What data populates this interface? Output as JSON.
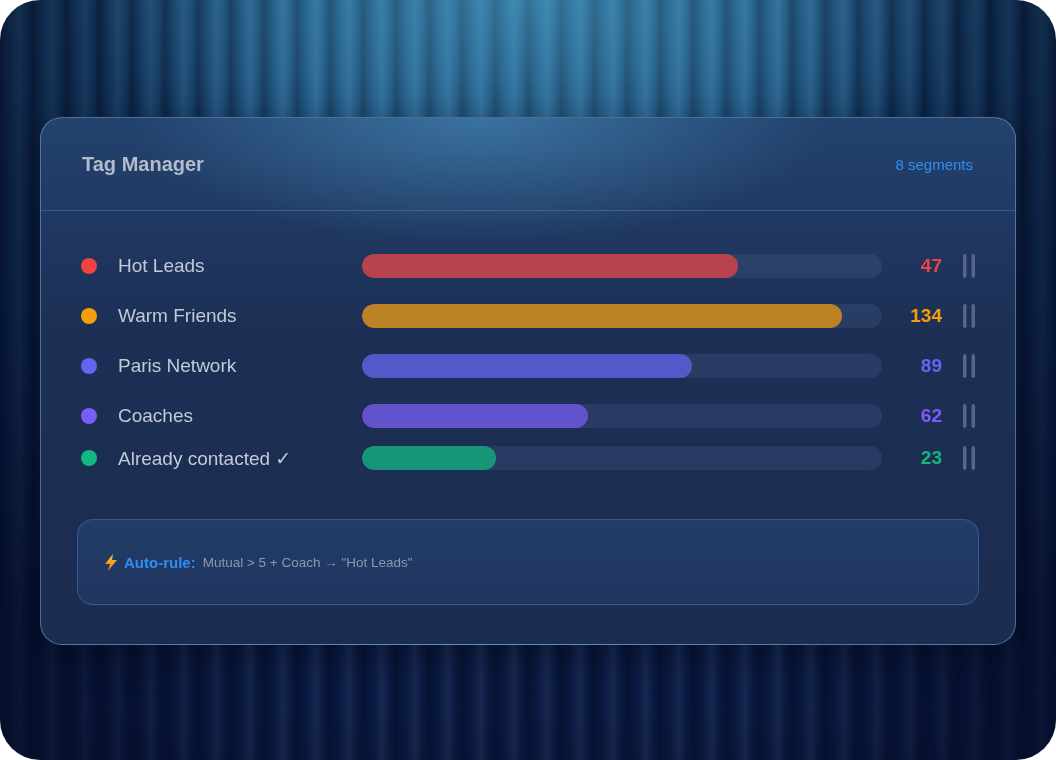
{
  "card": {
    "title": "Tag Manager",
    "segments": "8 segments"
  },
  "tags": [
    {
      "name": "Hot Leads",
      "color": "#ef4444",
      "level": 0.723,
      "count": "47"
    },
    {
      "name": "Warm Friends",
      "color": "#f59e0b",
      "level": 0.923,
      "count": "134"
    },
    {
      "name": "Paris Network",
      "color": "#6366f1",
      "level": 0.635,
      "count": "89"
    },
    {
      "name": "Coaches",
      "color": "#7c5cf6",
      "level": 0.435,
      "count": "62"
    },
    {
      "name": "Already contacted ✓",
      "color": "#10b981",
      "level": 0.258,
      "count": "23"
    }
  ],
  "auto_rule": {
    "label": "Auto-rule:",
    "rule": "Mutual > 5 + Coach → \"Hot Leads\""
  }
}
